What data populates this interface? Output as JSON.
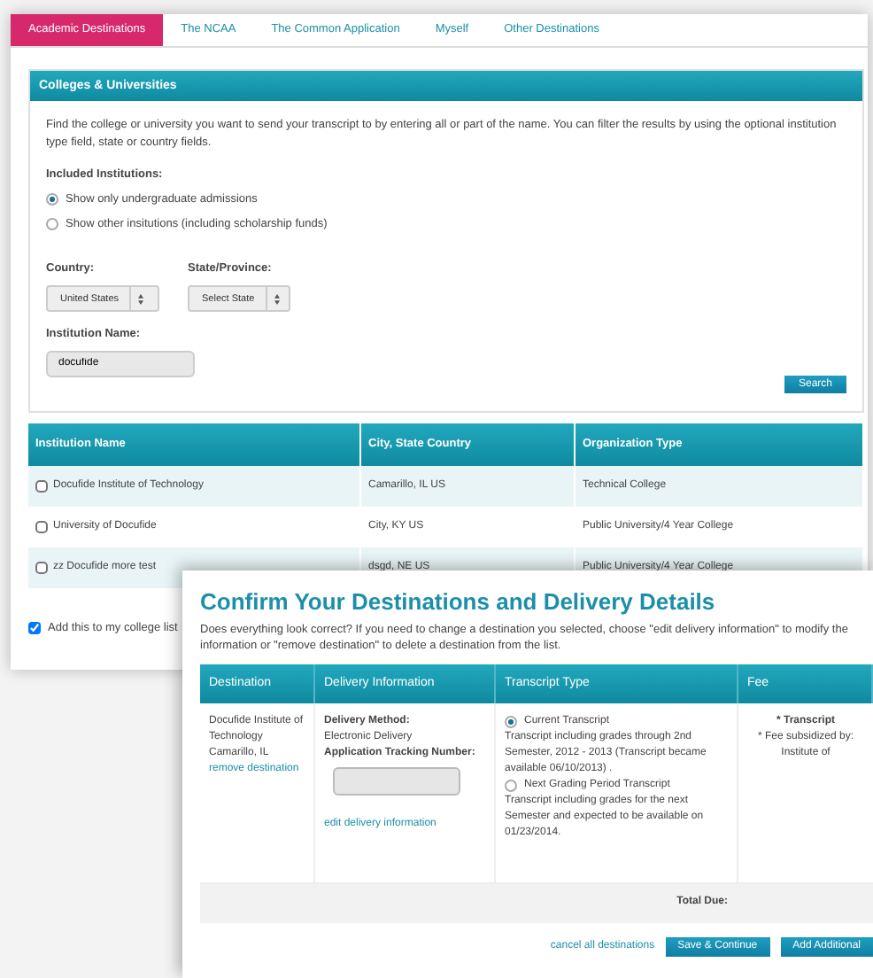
{
  "back_window": {
    "tabs": [
      {
        "label": "Academic Destinations",
        "selected": true
      },
      {
        "label": "The NCAA",
        "selected": false
      },
      {
        "label": "The Common Application",
        "selected": false
      },
      {
        "label": "Myself",
        "selected": false
      },
      {
        "label": "Other Destinations",
        "selected": false
      }
    ],
    "panel_title": "Colleges & Universities",
    "description": "Find the college or university you want to send your transcript to by entering all or part of the name. You can filter the results by using the optional institution type field, state or country fields.",
    "included_label": "Included Institutions:",
    "included_options": [
      {
        "label": "Show only undergraduate admissions",
        "selected": true
      },
      {
        "label": "Show other insitutions (including scholarship funds)",
        "selected": false
      }
    ],
    "country": {
      "label": "Country:",
      "value": "United States"
    },
    "state": {
      "label": "State/Province:",
      "value": "Select State"
    },
    "institution_name": {
      "label": "Institution Name:",
      "value": "docufide"
    },
    "search_button": "Search",
    "table": {
      "columns": [
        "Institution Name",
        "City, State Country",
        "Organization Type"
      ],
      "rows": [
        {
          "checked": false,
          "cells": [
            "Docufide Institute of Technology",
            "Camarillo, IL US",
            "Technical College"
          ]
        },
        {
          "checked": false,
          "cells": [
            "University of Docufide",
            "City, KY US",
            "Public University/4 Year College"
          ]
        },
        {
          "checked": false,
          "cells": [
            "zz Docufide more test",
            "dsgd, NE US",
            "Public University/4 Year College"
          ]
        }
      ]
    },
    "add_to_list": {
      "label": "Add this to my college list",
      "checked": true
    }
  },
  "front_window": {
    "title": "Confirm Your Destinations and Delivery Details",
    "intro": "Does everything look correct? If you need to change a destination you selected, choose \"edit delivery information\" to modify the information or \"remove destination\" to delete a destination from the list.",
    "table": {
      "columns": [
        "Destination",
        "Delivery Information",
        "Transcript Type",
        "Fee"
      ],
      "row": {
        "destination": "Docufide Institute of Technology",
        "city": "Camarillo, IL",
        "remove_link": "remove destination",
        "delivery_method_label": "Delivery Method:",
        "delivery_method": "Electronic Delivery",
        "tracking_label": "Application Tracking Number:",
        "edit_link": "edit delivery information",
        "transcript_options": [
          {
            "label": "Current Transcript",
            "selected": true,
            "description": "Transcript including grades through 2nd Semester, 2012 - 2013 (Transcript became available 06/10/2013) ."
          },
          {
            "label": "Next Grading Period Transcript",
            "selected": false,
            "description": "Transcript including grades for the next Semester and expected to be available on 01/23/2014."
          }
        ],
        "fee_title": "* Transcript",
        "fee_notes": [
          "* Fee subsidized by:",
          "Institute of"
        ]
      },
      "total_label": "Total Due:"
    },
    "cancel_link": "cancel all destinations",
    "buttons": [
      "Save & Continue",
      "Add Additional"
    ]
  }
}
